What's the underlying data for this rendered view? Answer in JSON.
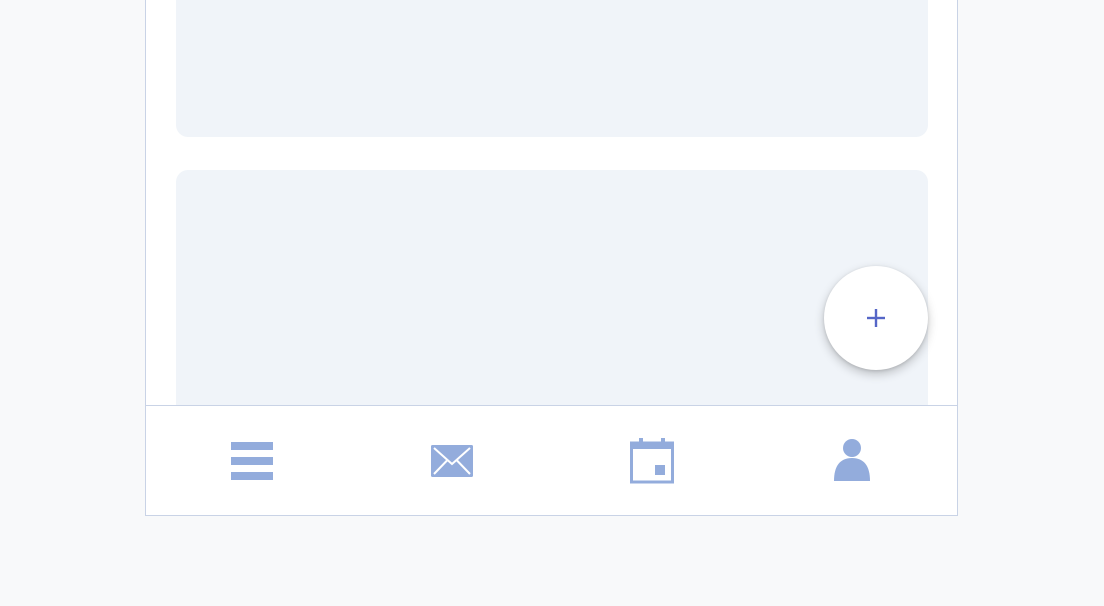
{
  "colors": {
    "page_background": "#f8f9fa",
    "frame_border": "#c9d3e6",
    "card_background": "#f0f4f9",
    "nav_icon": "#93acdc",
    "fab_icon": "#5566c7"
  },
  "content": {
    "cards": [
      {
        "id": "card-1"
      },
      {
        "id": "card-2"
      }
    ]
  },
  "fab": {
    "icon": "plus-icon"
  },
  "bottom_nav": {
    "items": [
      {
        "icon": "menu-icon"
      },
      {
        "icon": "mail-icon"
      },
      {
        "icon": "calendar-icon"
      },
      {
        "icon": "user-icon"
      }
    ]
  }
}
